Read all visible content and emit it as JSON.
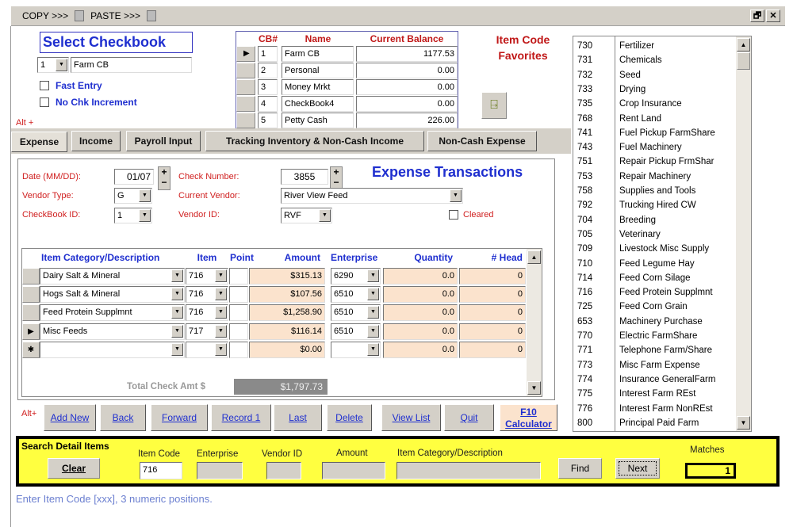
{
  "toolbar": {
    "copy": "COPY >>>",
    "paste": "PASTE >>>",
    "restore": "🗗",
    "close": "✕"
  },
  "checkbook": {
    "title": "Select Checkbook",
    "id": "1",
    "name": "Farm CB",
    "fast_entry": "Fast Entry",
    "no_chk_increment": "No Chk Increment",
    "alt": "Alt +"
  },
  "cb_table": {
    "headers": [
      "CB#",
      "Name",
      "Current Balance"
    ],
    "rows": [
      {
        "cb": "1",
        "name": "Farm CB",
        "balance": "1177.53"
      },
      {
        "cb": "2",
        "name": "Personal",
        "balance": "0.00"
      },
      {
        "cb": "3",
        "name": "Money Mrkt",
        "balance": "0.00"
      },
      {
        "cb": "4",
        "name": "CheckBook4",
        "balance": "0.00"
      },
      {
        "cb": "5",
        "name": "Petty Cash",
        "balance": "226.00"
      }
    ]
  },
  "favorites_title": "Item Code Favorites",
  "tabs": [
    "Expense",
    "Income",
    "Payroll Input",
    "Tracking Inventory & Non-Cash Income",
    "Non-Cash Expense"
  ],
  "form": {
    "title": "Expense Transactions",
    "date_label": "Date (MM/DD):",
    "date": "01/07",
    "check_label": "Check Number:",
    "check": "3855",
    "vtype_label": "Vendor Type:",
    "vtype": "G",
    "vendor_label": "Current Vendor:",
    "vendor": "River View Feed",
    "cbid_label": "CheckBook ID:",
    "cbid": "1",
    "vid_label": "Vendor ID:",
    "vid": "RVF",
    "cleared": "Cleared"
  },
  "grid": {
    "headers": [
      "Item Category/Description",
      "Item",
      "Point",
      "Amount",
      "Enterprise",
      "Quantity",
      "# Head"
    ],
    "rows": [
      {
        "desc": "Dairy Salt & Mineral",
        "item": "716",
        "point": "",
        "amount": "$315.13",
        "ent": "6290",
        "qty": "0.0",
        "head": "0"
      },
      {
        "desc": "Hogs Salt & Mineral",
        "item": "716",
        "point": "",
        "amount": "$107.56",
        "ent": "6510",
        "qty": "0.0",
        "head": "0"
      },
      {
        "desc": "Feed Protein Supplmnt",
        "item": "716",
        "point": "",
        "amount": "$1,258.90",
        "ent": "6510",
        "qty": "0.0",
        "head": "0"
      },
      {
        "desc": "Misc Feeds",
        "item": "717",
        "point": "",
        "amount": "$116.14",
        "ent": "6510",
        "qty": "0.0",
        "head": "0"
      },
      {
        "desc": "",
        "item": "",
        "point": "",
        "amount": "$0.00",
        "ent": "",
        "qty": "0.0",
        "head": "0"
      }
    ],
    "total_label": "Total Check Amt $",
    "total": "$1,797.73"
  },
  "buttons": {
    "alt": "Alt+",
    "items": [
      "Add New",
      "Back",
      "Forward",
      "Record 1",
      "Last",
      "Delete",
      "View List",
      "Quit"
    ],
    "f10": "F10",
    "calc": "Calculator"
  },
  "favorites": [
    [
      "730",
      "Fertilizer"
    ],
    [
      "731",
      "Chemicals"
    ],
    [
      "732",
      "Seed"
    ],
    [
      "733",
      "Drying"
    ],
    [
      "735",
      "Crop Insurance"
    ],
    [
      "768",
      "Rent Land"
    ],
    [
      "741",
      "Fuel Pickup FarmShare"
    ],
    [
      "743",
      "Fuel Machinery"
    ],
    [
      "751",
      "Repair Pickup FrmShar"
    ],
    [
      "753",
      "Repair Machinery"
    ],
    [
      "758",
      "Supplies and Tools"
    ],
    [
      "792",
      "Trucking Hired CW"
    ],
    [
      "704",
      "Breeding"
    ],
    [
      "705",
      "Veterinary"
    ],
    [
      "709",
      "Livestock Misc Supply"
    ],
    [
      "710",
      "Feed Legume Hay"
    ],
    [
      "714",
      "Feed Corn Silage"
    ],
    [
      "716",
      "Feed Protein Supplmnt"
    ],
    [
      "725",
      "Feed Corn Grain"
    ],
    [
      "653",
      "Machinery Purchase"
    ],
    [
      "770",
      "Electric FarmShare"
    ],
    [
      "771",
      "Telephone Farm/Share"
    ],
    [
      "773",
      "Misc Farm Expense"
    ],
    [
      "774",
      "Insurance GeneralFarm"
    ],
    [
      "775",
      "Interest Farm REst"
    ],
    [
      "776",
      "Interest Farm NonREst"
    ],
    [
      "800",
      "Principal Paid Farm"
    ]
  ],
  "search": {
    "title": "Search Detail Items",
    "clear": "Clear",
    "item_code_label": "Item Code",
    "item_code": "716",
    "enterprise_label": "Enterprise",
    "vendor_label": "Vendor ID",
    "amount_label": "Amount",
    "desc_label": "Item Category/Description",
    "find": "Find",
    "next": "Next",
    "matches_label": "Matches",
    "matches": "1"
  },
  "status": "Enter Item Code [xxx], 3 numeric positions."
}
